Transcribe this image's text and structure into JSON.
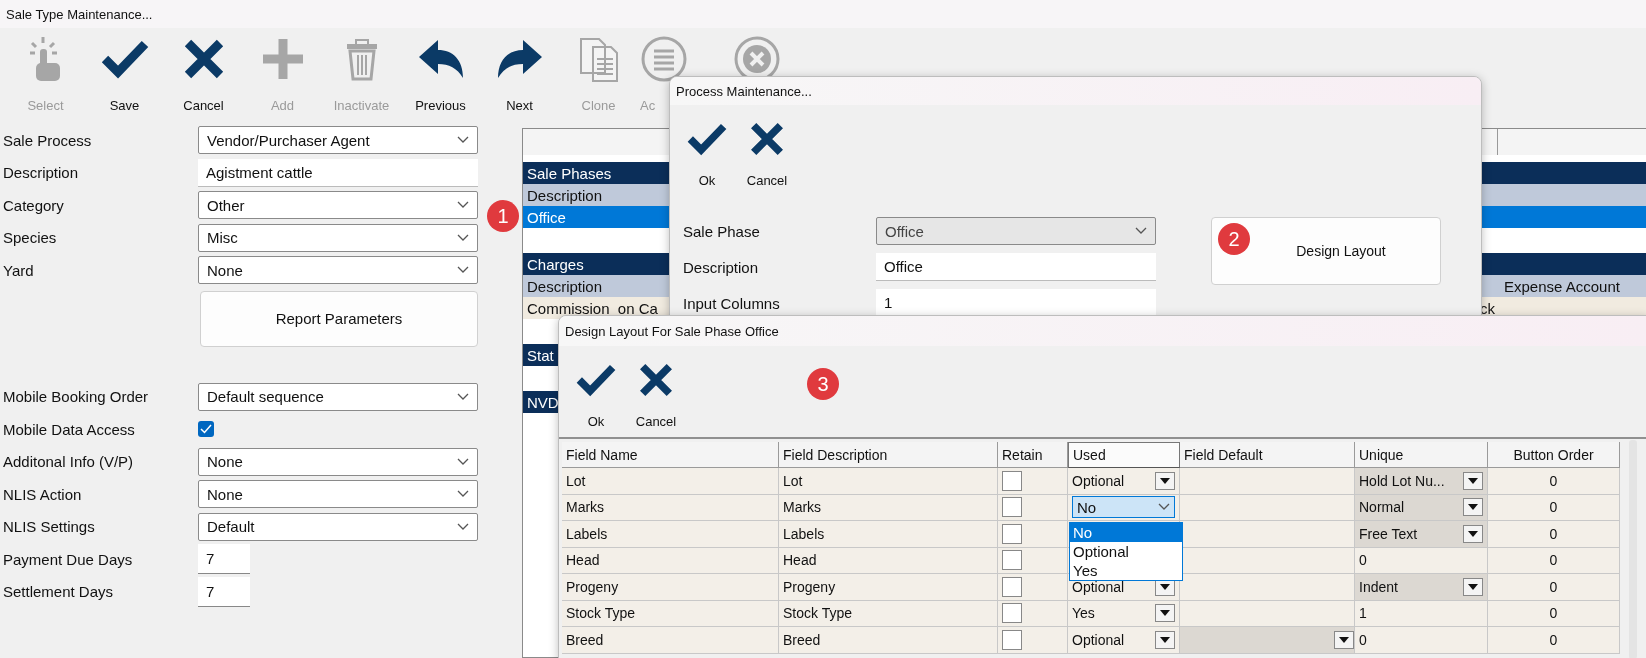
{
  "main_window": {
    "title": "Sale Type Maintenance...",
    "badge": "1",
    "toolbar": [
      {
        "label": "Select",
        "kind": "pointer",
        "disabled": true,
        "cut_off": false
      },
      {
        "label": "Save",
        "kind": "check",
        "disabled": false,
        "cut_off": false
      },
      {
        "label": "Cancel",
        "kind": "cross",
        "disabled": false,
        "cut_off": false
      },
      {
        "label": "Add",
        "kind": "plus",
        "disabled": true,
        "cut_off": false
      },
      {
        "label": "Inactivate",
        "kind": "trash",
        "disabled": true,
        "cut_off": false
      },
      {
        "label": "Previous",
        "kind": "back",
        "disabled": false,
        "cut_off": false
      },
      {
        "label": "Next",
        "kind": "forward",
        "disabled": false,
        "cut_off": false
      },
      {
        "label": "Clone",
        "kind": "copy",
        "disabled": true,
        "cut_off": false
      },
      {
        "label": "Ac",
        "kind": "list",
        "disabled": true,
        "cut_off": true
      },
      {
        "kind": "close-circle",
        "disabled": true,
        "cut_off": false
      }
    ],
    "form_top": [
      {
        "label": "Sale Process",
        "kind": "dropdown",
        "value": "Vendor/Purchaser Agent"
      },
      {
        "label": "Description",
        "kind": "text",
        "value": "Agistment cattle"
      },
      {
        "label": "Category",
        "kind": "dropdown",
        "value": "Other"
      },
      {
        "label": "Species",
        "kind": "dropdown",
        "value": "Misc"
      },
      {
        "label": "Yard",
        "kind": "dropdown",
        "value": "None"
      }
    ],
    "report_button": "Report Parameters",
    "form_bottom": [
      {
        "label": "Mobile Booking Order",
        "kind": "dropdown",
        "value": "Default sequence"
      },
      {
        "label": "Mobile Data Access",
        "kind": "checkbox",
        "checked": true
      },
      {
        "label": "Additonal Info (V/P)",
        "kind": "dropdown",
        "value": "None"
      },
      {
        "label": "NLIS Action",
        "kind": "dropdown",
        "value": "None"
      },
      {
        "label": "NLIS Settings",
        "kind": "dropdown",
        "value": "Default"
      },
      {
        "label": "Payment Due Days",
        "kind": "number",
        "value": "7"
      },
      {
        "label": "Settlement Days",
        "kind": "number",
        "value": "7"
      }
    ],
    "grid": {
      "sections": [
        {
          "title": "Sale Phases",
          "headers": {
            "column_1": "Description"
          },
          "rows": [
            {
              "column_1": "Office",
              "selected": true
            }
          ]
        },
        {
          "title": "Charges",
          "headers": {
            "column_1": "Description",
            "column_3": "Expense Account"
          },
          "rows": [
            {
              "column_1": "Commission_on Ca",
              "column_2": "ck",
              "selected": false
            }
          ]
        },
        {
          "title": "Stat"
        },
        {
          "title": "NVD"
        }
      ]
    }
  },
  "process_window": {
    "title": "Process Maintenance...",
    "badge": "2",
    "buttons": [
      {
        "label": "Ok",
        "kind": "check"
      },
      {
        "label": "Cancel",
        "kind": "cross"
      }
    ],
    "fields": [
      {
        "label": "Sale Phase",
        "kind": "dropdown",
        "disabled": true,
        "value": "Office"
      },
      {
        "label": "Description",
        "kind": "text",
        "disabled": false,
        "value": "Office"
      },
      {
        "label": "Input Columns",
        "kind": "text",
        "disabled": false,
        "value": "1"
      }
    ],
    "design_button": "Design Layout"
  },
  "design_window": {
    "title": "Design Layout For Sale Phase Office",
    "badge": "3",
    "buttons": [
      {
        "label": "Ok",
        "kind": "check"
      },
      {
        "label": "Cancel",
        "kind": "cross"
      }
    ],
    "columns": [
      "Field Name",
      "Field Description",
      "Retain",
      "Used",
      "Field Default",
      "Unique",
      "Button Order"
    ],
    "rows": [
      {
        "name": "Lot",
        "description": "Lot",
        "retain": false,
        "used": {
          "kind": "dropdown",
          "value": "Optional"
        },
        "default": {
          "kind": "empty"
        },
        "unique": {
          "kind": "dropdown",
          "value": "Hold Lot Nu..."
        },
        "button_order": "0"
      },
      {
        "name": "Marks",
        "description": "Marks",
        "retain": false,
        "used": {
          "kind": "open",
          "value": "No"
        },
        "default": {
          "kind": "empty"
        },
        "unique": {
          "kind": "dropdown",
          "value": "Normal"
        },
        "button_order": "0"
      },
      {
        "name": "Labels",
        "description": "Labels",
        "retain": false,
        "used": {
          "kind": "hidden"
        },
        "default": {
          "kind": "empty"
        },
        "unique": {
          "kind": "dropdown",
          "value": "Free Text"
        },
        "button_order": "0"
      },
      {
        "name": "Head",
        "description": "Head",
        "retain": false,
        "used": {
          "kind": "hidden"
        },
        "default": {
          "kind": "empty"
        },
        "unique": {
          "kind": "text",
          "value": "0"
        },
        "button_order": "0"
      },
      {
        "name": "Progeny",
        "description": "Progeny",
        "retain": false,
        "used": {
          "kind": "dropdown",
          "value": "Optional"
        },
        "default": {
          "kind": "empty"
        },
        "unique": {
          "kind": "dropdown",
          "value": "Indent"
        },
        "button_order": "0"
      },
      {
        "name": "Stock Type",
        "description": "Stock Type",
        "retain": false,
        "used": {
          "kind": "dropdown",
          "value": "Yes"
        },
        "default": {
          "kind": "empty"
        },
        "unique": {
          "kind": "text",
          "value": "1"
        },
        "button_order": "0"
      },
      {
        "name": "Breed",
        "description": "Breed",
        "retain": false,
        "used": {
          "kind": "dropdown",
          "value": "Optional"
        },
        "default": {
          "kind": "dropdown"
        },
        "unique": {
          "kind": "text",
          "value": "0"
        },
        "button_order": "0"
      }
    ],
    "open_list": [
      {
        "label": "No",
        "selected": true
      },
      {
        "label": "Optional",
        "selected": false
      },
      {
        "label": "Yes",
        "selected": false
      }
    ]
  }
}
